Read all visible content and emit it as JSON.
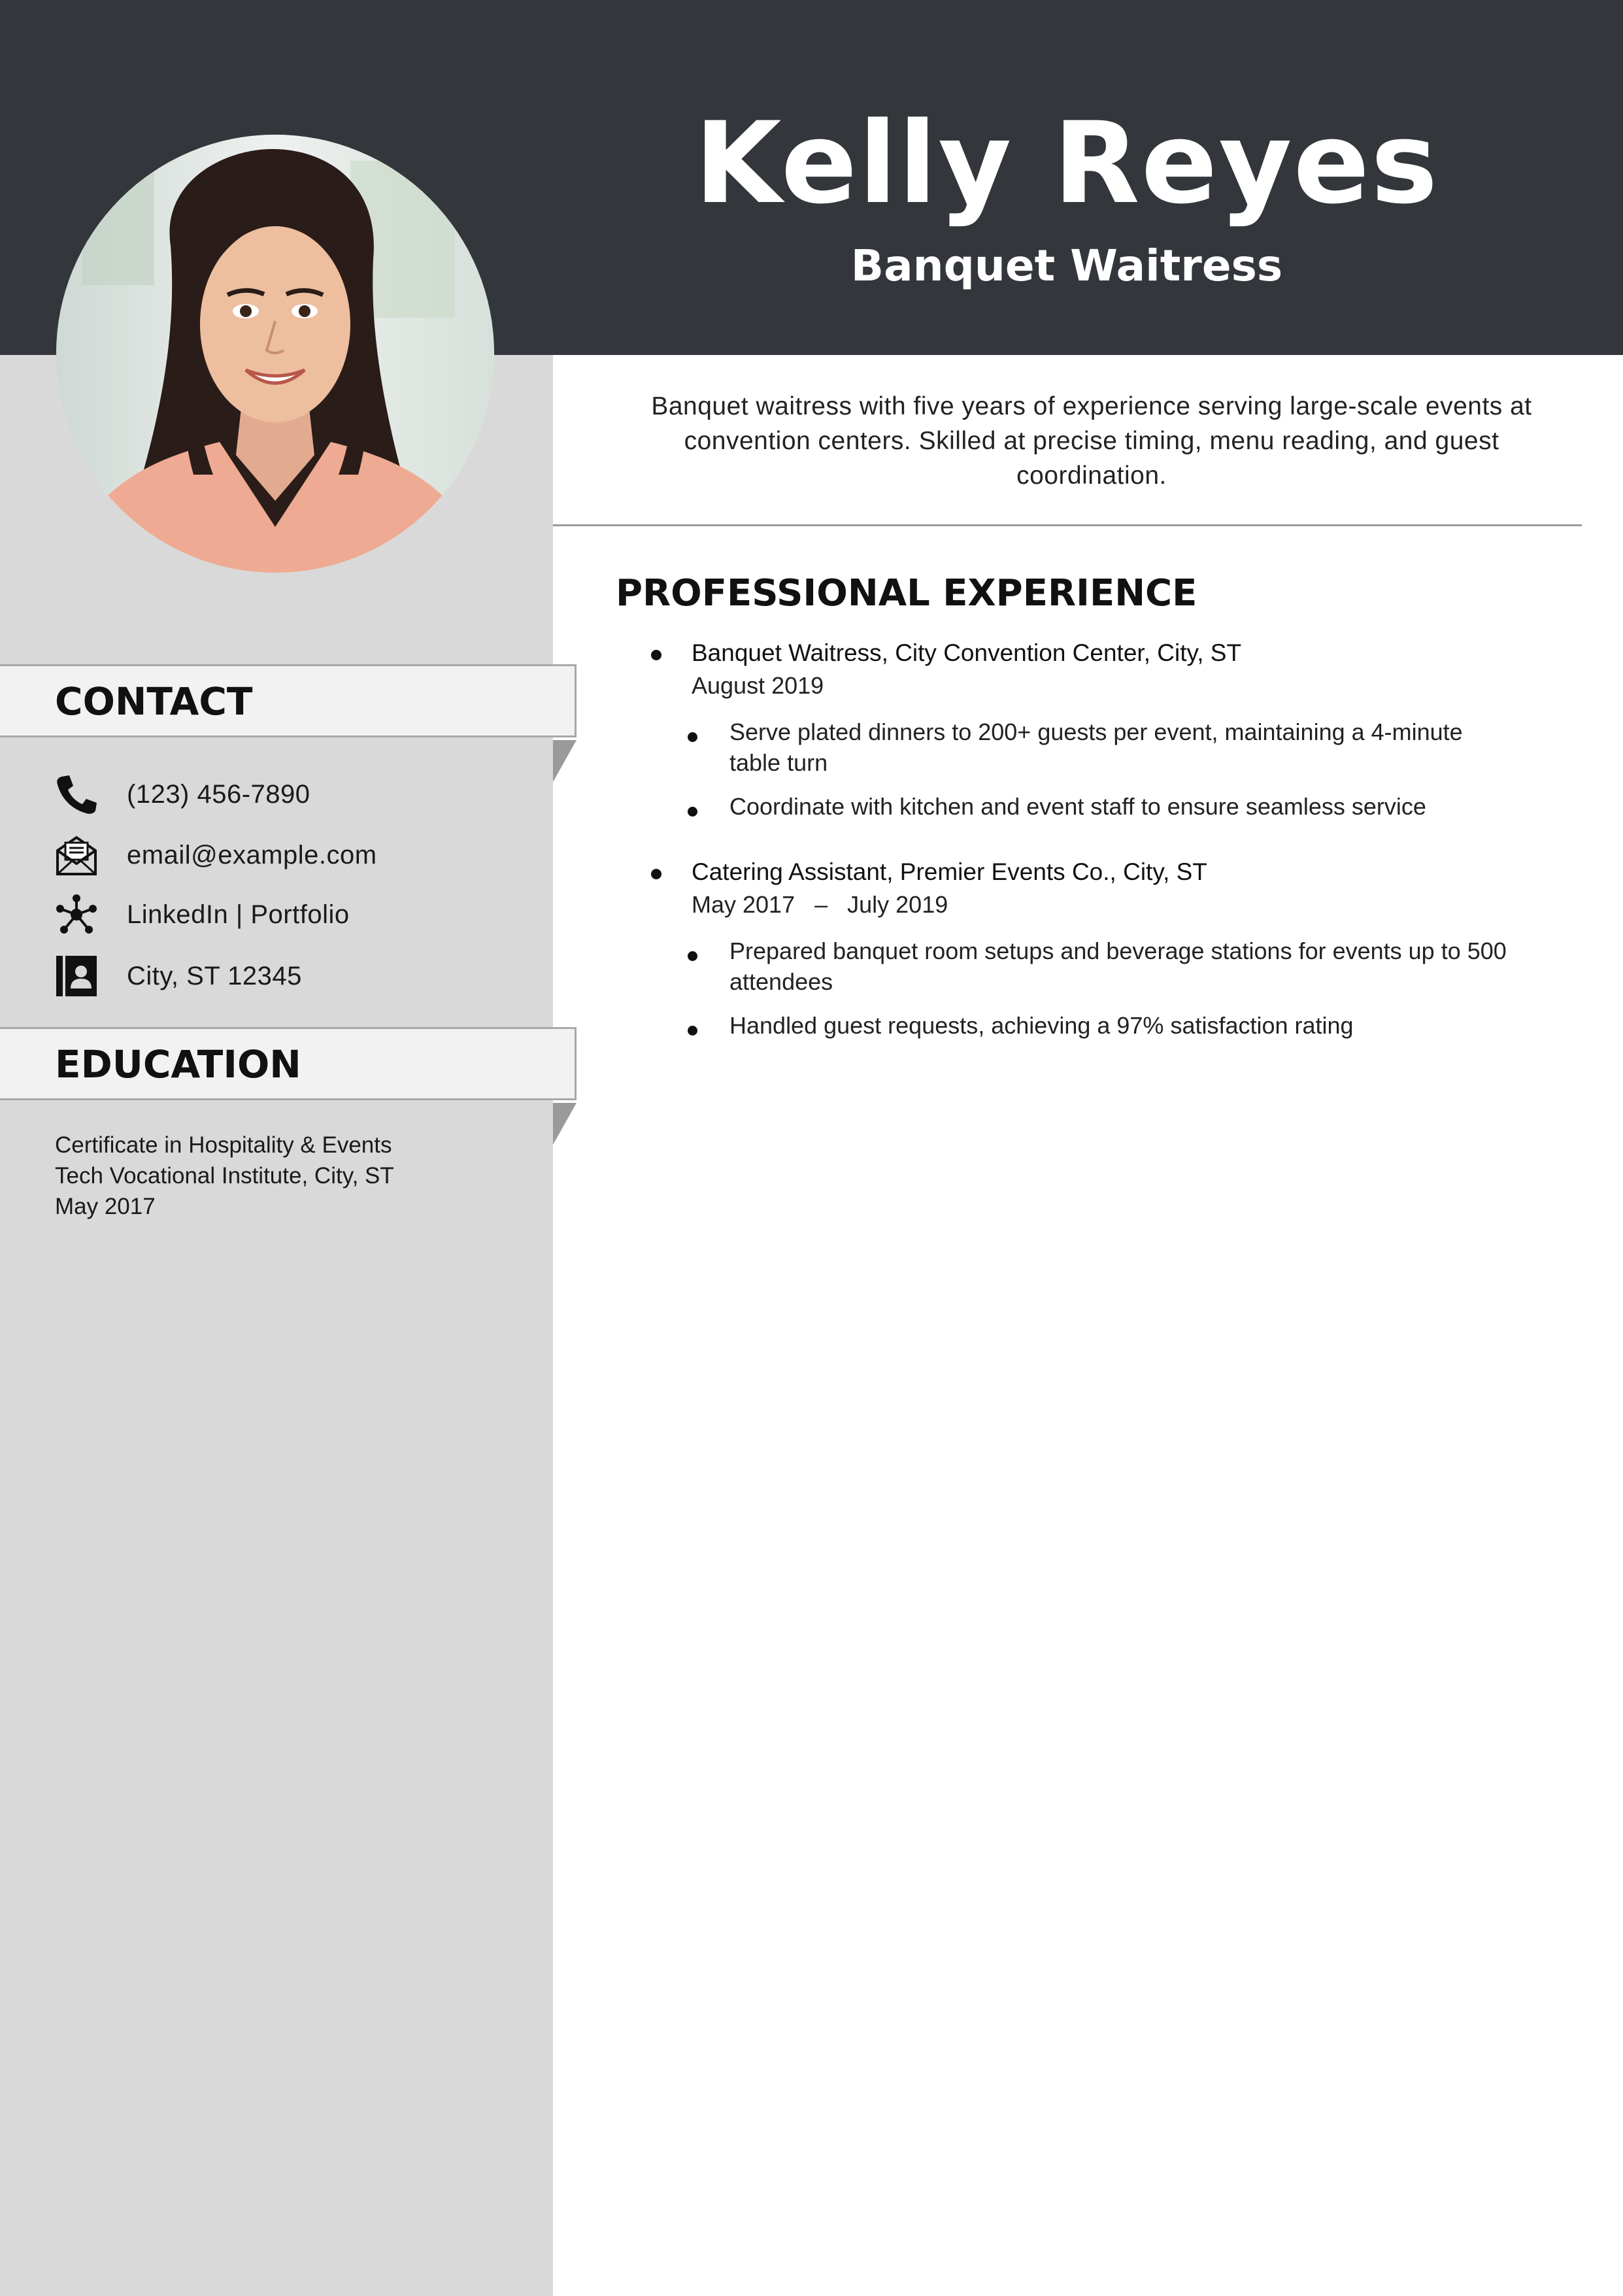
{
  "header": {
    "name": "Kelly Reyes",
    "role": "Banquet Waitress"
  },
  "summary": "Banquet waitress with five years of experience serving large-scale events at convention centers. Skilled at precise timing, menu reading, and guest coordination.",
  "experience": {
    "title": "PROFESSIONAL EXPERIENCE",
    "jobs": [
      {
        "title": "Banquet Waitress, City Convention Center, City, ST",
        "date": "August 2019",
        "bullets": [
          "Serve plated dinners to 200+ guests per event, maintaining a 4-minute table turn",
          "Coordinate with kitchen and event staff to ensure seamless service"
        ]
      },
      {
        "title": "Catering Assistant, Premier Events Co., City, ST",
        "date": "May 2017   –   July 2019",
        "bullets": [
          "Prepared banquet room setups and beverage stations for events up to 500 attendees",
          "Handled guest requests, achieving a 97% satisfaction rating"
        ]
      }
    ]
  },
  "contact": {
    "title": "CONTACT",
    "items": [
      {
        "icon": "phone-icon",
        "text": "(123) 456-7890"
      },
      {
        "icon": "envelope-icon",
        "text": "email@example.com"
      },
      {
        "icon": "network-icon",
        "text": "LinkedIn | Portfolio"
      },
      {
        "icon": "address-book-icon",
        "text": "City, ST 12345"
      }
    ]
  },
  "education": {
    "title": "EDUCATION",
    "lines": [
      "Certificate in Hospitality & Events",
      "Tech Vocational Institute, City, ST",
      "May 2017"
    ]
  },
  "colors": {
    "header_bg": "#33363b",
    "sidebar_bg": "#d9d9d9",
    "band_bg": "#f2f2f2"
  }
}
